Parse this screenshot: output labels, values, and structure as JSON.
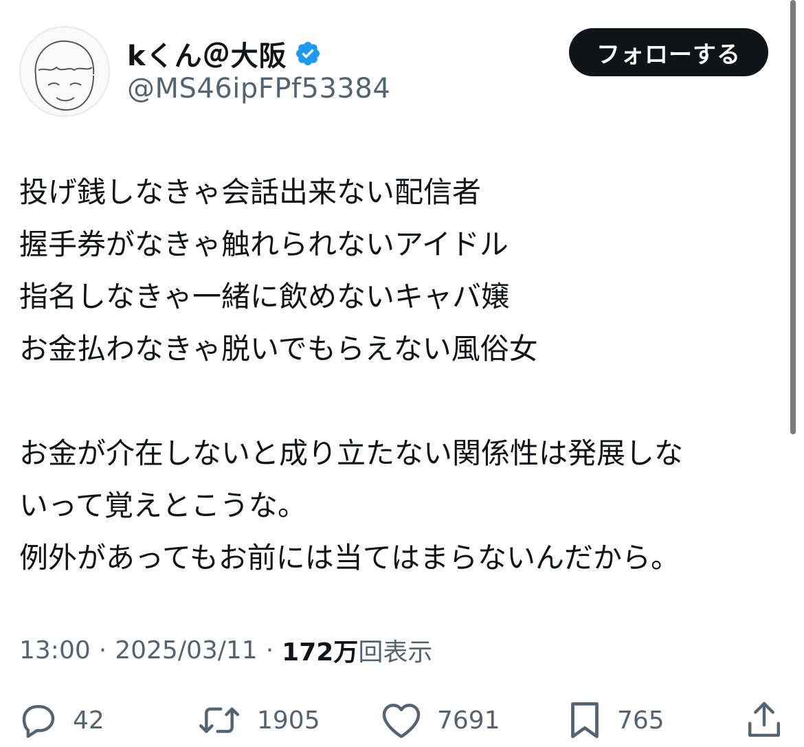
{
  "author": {
    "display_name": "kくん＠大阪",
    "handle": "@MS46ipFPf53384",
    "verified_icon": "verified-badge-icon",
    "verified_color": "#1d9bf0"
  },
  "follow_button": {
    "label": "フォローする"
  },
  "tweet": {
    "lines": [
      "投げ銭しなきゃ会話出来ない配信者",
      "握手券がなきゃ触れられないアイドル",
      "指名しなきゃ一緒に飲めないキャバ嬢",
      "お金払わなきゃ脱いでもらえない風俗女",
      "",
      "お金が介在しないと成り立たない関係性は発展しな",
      "いって覚えとこうな。",
      "例外があってもお前には当てはまらないんだから。"
    ]
  },
  "meta": {
    "time": "13:00",
    "separator": "·",
    "date": "2025/03/11",
    "views_count": "172万",
    "views_label": "回表示"
  },
  "actions": {
    "reply": {
      "icon": "reply-icon",
      "count": "42"
    },
    "repost": {
      "icon": "repost-icon",
      "count": "1905"
    },
    "like": {
      "icon": "heart-icon",
      "count": "7691"
    },
    "bookmark": {
      "icon": "bookmark-icon",
      "count": "765"
    },
    "share": {
      "icon": "share-icon"
    }
  },
  "colors": {
    "text": "#0f1419",
    "secondary": "#536471",
    "button_bg": "#0f1419"
  }
}
